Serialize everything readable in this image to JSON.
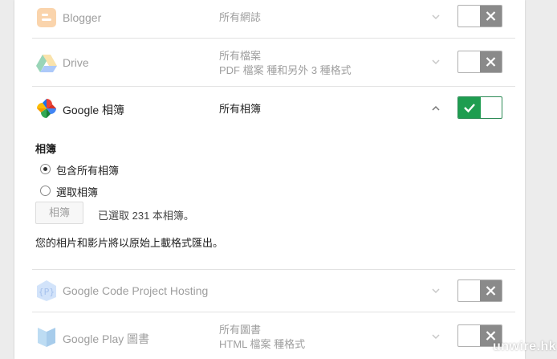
{
  "services": [
    {
      "name": "Blogger",
      "desc_line1": "所有網誌",
      "desc_line2": "",
      "expanded": false,
      "enabled": false,
      "icon": "blogger-icon"
    },
    {
      "name": "Drive",
      "desc_line1": "所有檔案",
      "desc_line2": "PDF 檔案 種和另外 3 種格式",
      "expanded": false,
      "enabled": false,
      "icon": "drive-icon"
    },
    {
      "name": "Google 相簿",
      "desc_line1": "所有相簿",
      "desc_line2": "",
      "expanded": true,
      "enabled": true,
      "icon": "google-photos-icon"
    },
    {
      "name": "Google Code Project Hosting",
      "desc_line1": "",
      "desc_line2": "",
      "expanded": false,
      "enabled": false,
      "icon": "project-hosting-icon"
    },
    {
      "name": "Google Play 圖書",
      "desc_line1": "所有圖書",
      "desc_line2": "HTML 檔案 種格式",
      "expanded": false,
      "enabled": false,
      "icon": "play-books-icon"
    }
  ],
  "photos_detail": {
    "section_title": "相簿",
    "options": [
      {
        "label": "包含所有相簿",
        "selected": true
      },
      {
        "label": "選取相簿",
        "selected": false
      }
    ],
    "albums_button_label": "相簿",
    "albums_status": "已選取 231 本相簿。",
    "export_note": "您的相片和影片將以原始上載格式匯出。"
  },
  "watermark": "unwire.hk",
  "colors": {
    "toggle_on": "#1e9d50",
    "toggle_off": "#8a8a8a"
  }
}
